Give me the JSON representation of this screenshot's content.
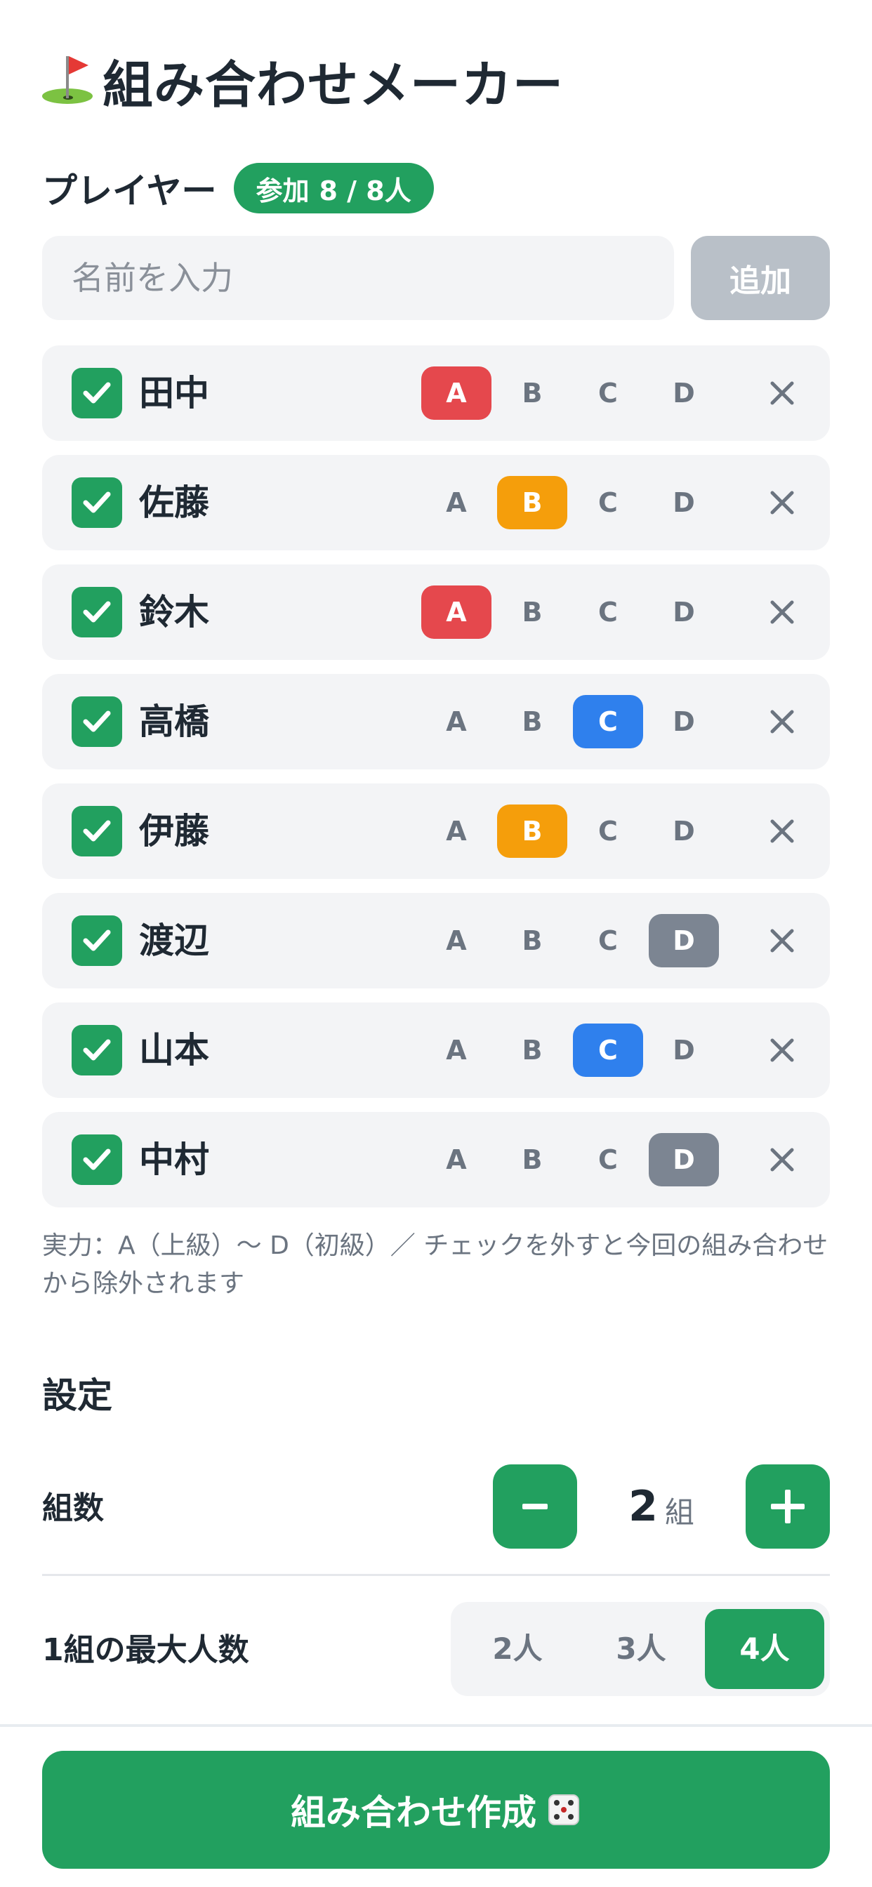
{
  "app": {
    "title": "組み合わせメーカー"
  },
  "players_section": {
    "title": "プレイヤー",
    "badge_label": "参加",
    "badge_count": "8 / 8人"
  },
  "name_input": {
    "placeholder": "名前を入力",
    "value": ""
  },
  "add_button": {
    "label": "追加"
  },
  "level_labels": [
    "A",
    "B",
    "C",
    "D"
  ],
  "players": [
    {
      "name": "田中",
      "checked": true,
      "level": "A"
    },
    {
      "name": "佐藤",
      "checked": true,
      "level": "B"
    },
    {
      "name": "鈴木",
      "checked": true,
      "level": "A"
    },
    {
      "name": "高橋",
      "checked": true,
      "level": "C"
    },
    {
      "name": "伊藤",
      "checked": true,
      "level": "B"
    },
    {
      "name": "渡辺",
      "checked": true,
      "level": "D"
    },
    {
      "name": "山本",
      "checked": true,
      "level": "C"
    },
    {
      "name": "中村",
      "checked": true,
      "level": "D"
    }
  ],
  "hint": "実力：A（上級）〜 D（初級）／ チェックを外すと今回の組み合わせから除外されます",
  "settings": {
    "title": "設定",
    "group_count": {
      "label": "組数",
      "value": "2",
      "unit": "組"
    },
    "max_per_group": {
      "label": "1組の最大人数",
      "options": [
        "2人",
        "3人",
        "4人"
      ],
      "selected": "4人"
    }
  },
  "create_button": {
    "label": "組み合わせ作成"
  },
  "colors": {
    "accent": "#22a05f",
    "level_A": "#e5484d",
    "level_B": "#f59e0b",
    "level_C": "#2f80ed",
    "level_D": "#7c8592"
  },
  "icons": {
    "title": "golf-flag-icon",
    "check": "check-icon",
    "remove": "close-icon",
    "minus": "minus-icon",
    "plus": "plus-icon",
    "create": "dice-icon"
  }
}
